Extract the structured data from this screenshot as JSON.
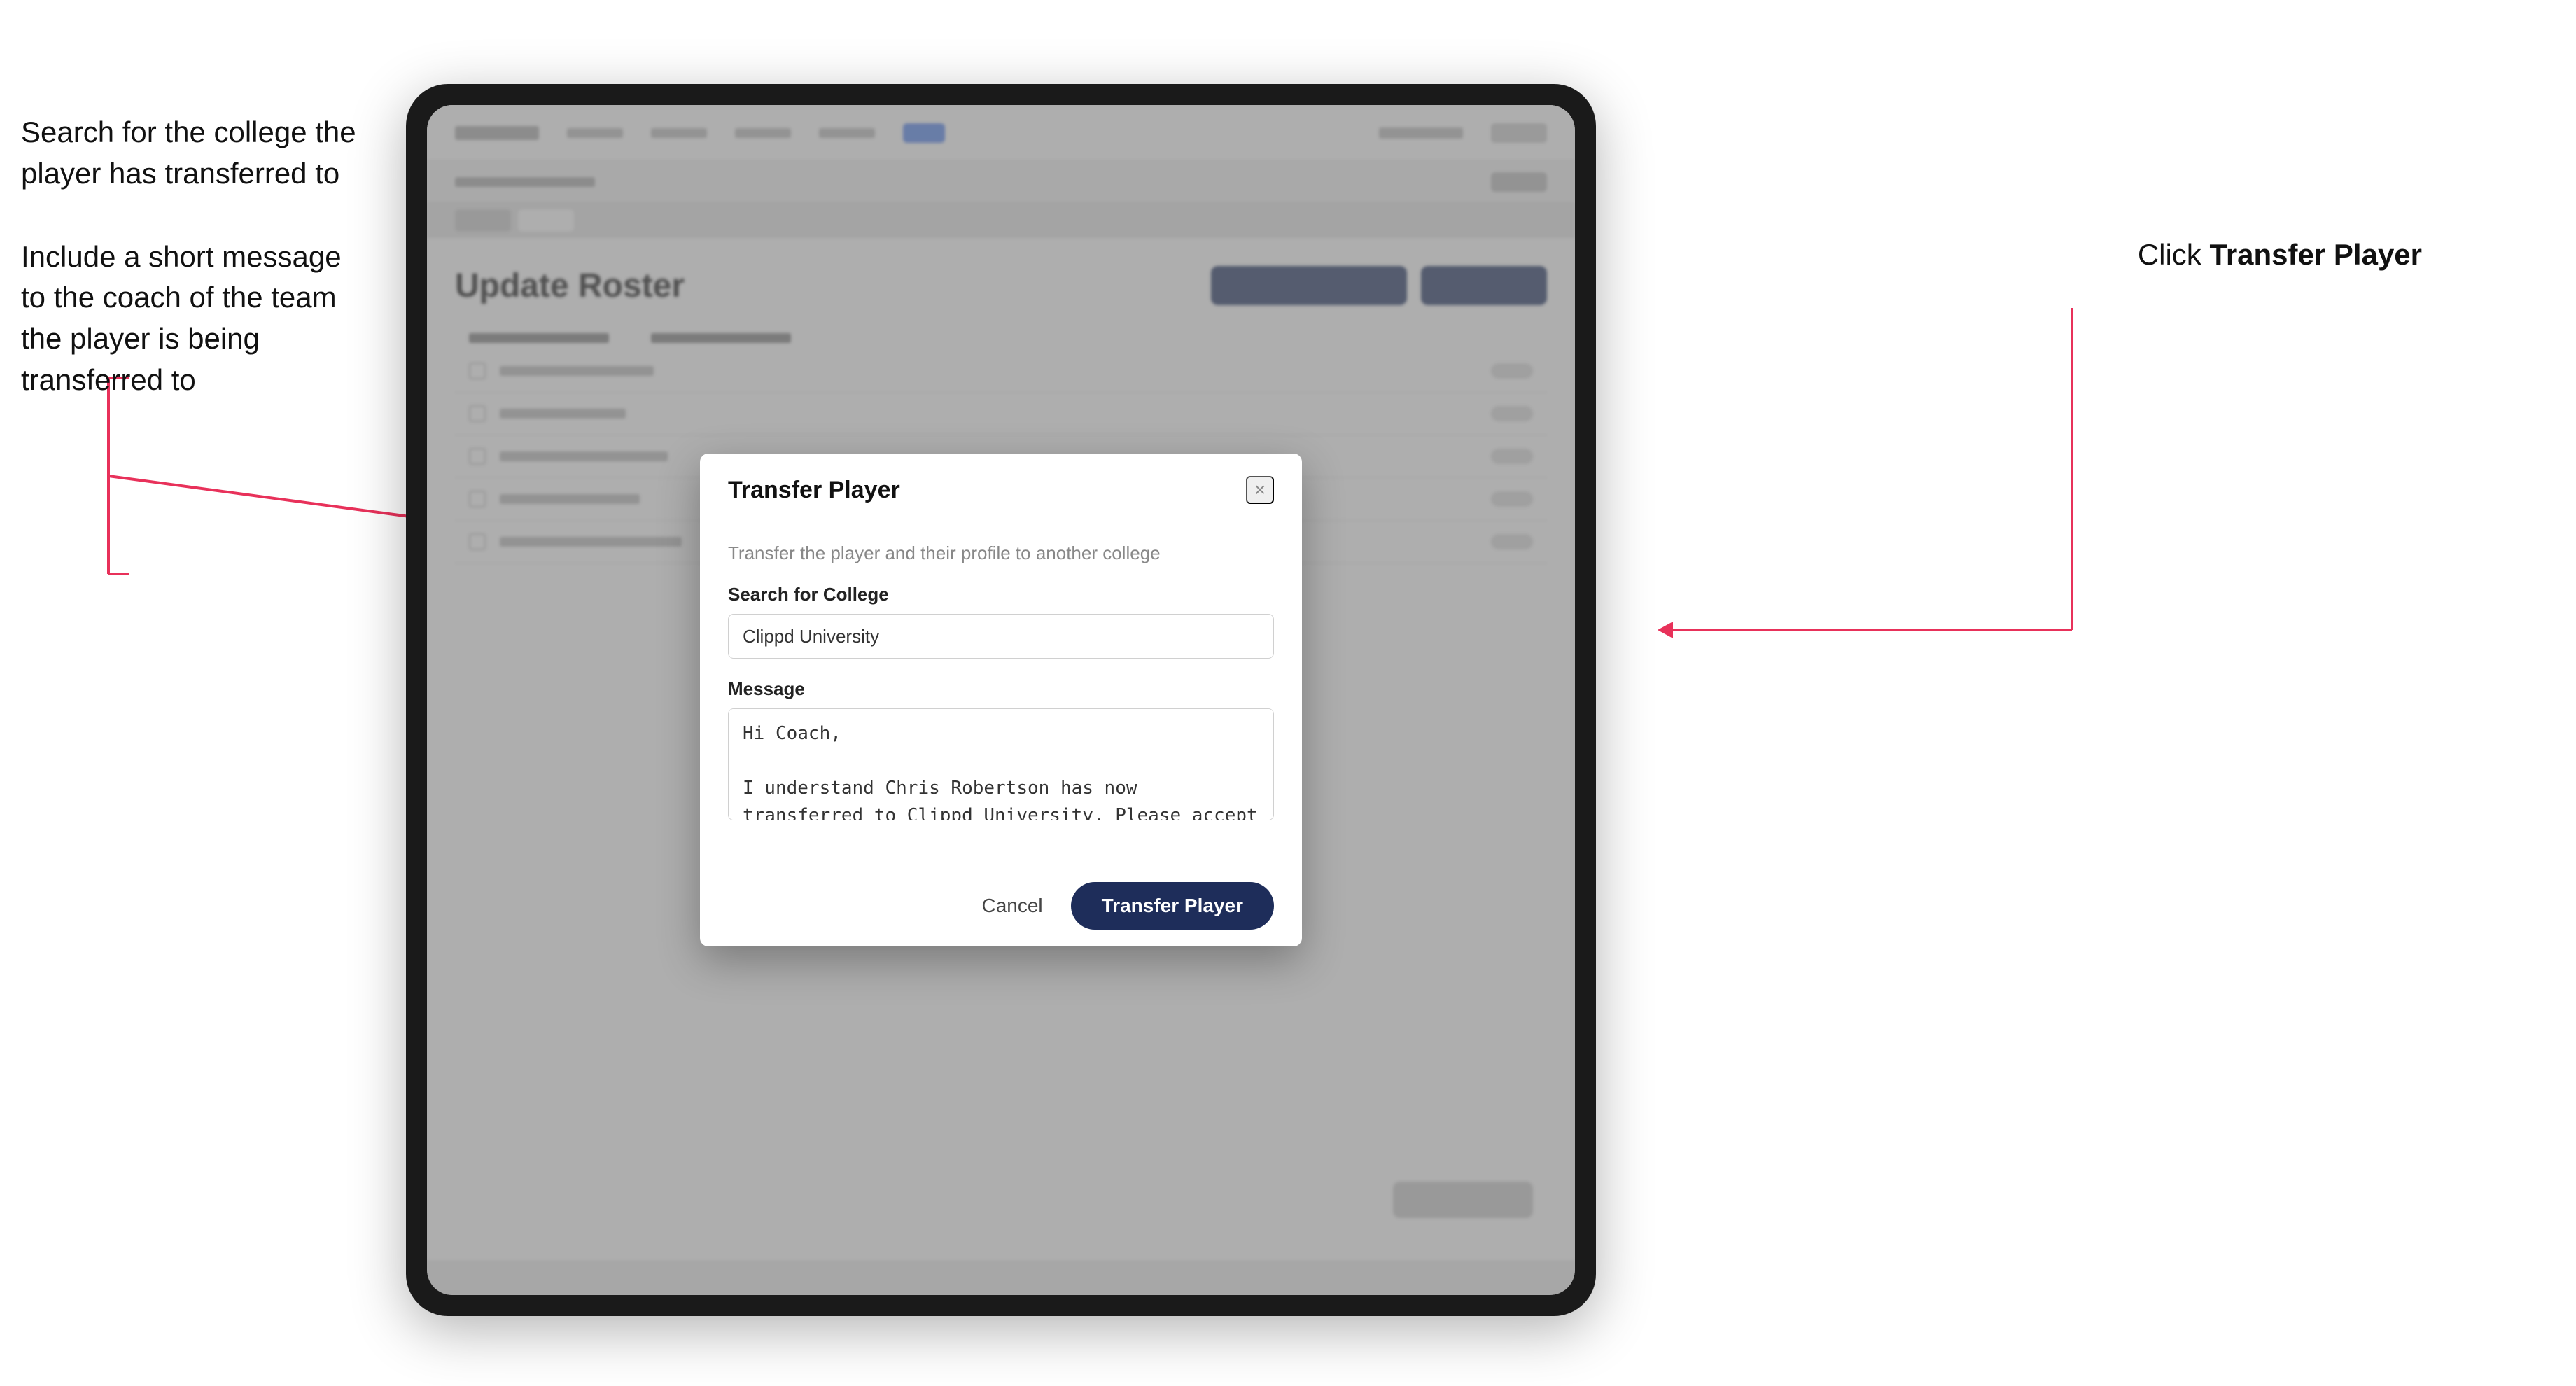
{
  "annotations": {
    "left_line1": "Search for the college the",
    "left_line2": "player has transferred to",
    "left_line3": "Include a short message",
    "left_line4": "to the coach of the team",
    "left_line5": "the player is being",
    "left_line6": "transferred to",
    "right_text": "Click ",
    "right_bold": "Transfer Player"
  },
  "modal": {
    "title": "Transfer Player",
    "close_icon": "×",
    "description": "Transfer the player and their profile to another college",
    "search_label": "Search for College",
    "search_value": "Clippd University",
    "message_label": "Message",
    "message_value": "Hi Coach,\n\nI understand Chris Robertson has now transferred to Clippd University. Please accept this transfer request when you can.",
    "cancel_label": "Cancel",
    "transfer_label": "Transfer Player"
  },
  "page": {
    "title": "Update Roster"
  }
}
